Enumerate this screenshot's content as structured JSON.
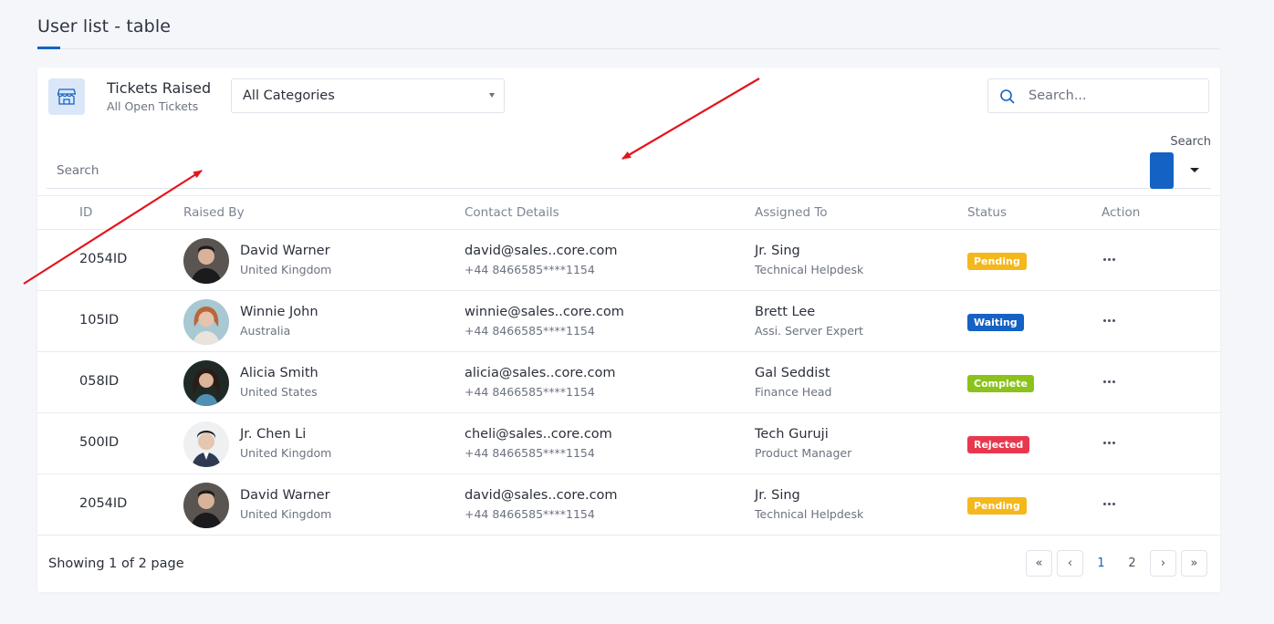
{
  "page": {
    "title": "User list - table"
  },
  "card": {
    "title": "Tickets Raised",
    "subtitle": "All Open Tickets",
    "category_select": {
      "value": "All Categories"
    },
    "top_search": {
      "placeholder": "Search..."
    },
    "search_bar": {
      "label": "Search",
      "placeholder": "Search"
    }
  },
  "table": {
    "headers": {
      "id": "ID",
      "raised_by": "Raised By",
      "contact": "Contact Details",
      "assigned": "Assigned To",
      "status": "Status",
      "action": "Action"
    },
    "rows": [
      {
        "id": "2054ID",
        "name": "David Warner",
        "country": "United Kingdom",
        "email": "david@sales..core.com",
        "phone": "+44 8466585****1154",
        "assigned": "Jr. Sing",
        "role": "Technical Helpdesk",
        "status": "Pending"
      },
      {
        "id": "105ID",
        "name": "Winnie John",
        "country": "Australia",
        "email": "winnie@sales..core.com",
        "phone": "+44 8466585****1154",
        "assigned": "Brett Lee",
        "role": "Assi. Server Expert",
        "status": "Waiting"
      },
      {
        "id": "058ID",
        "name": "Alicia Smith",
        "country": "United States",
        "email": "alicia@sales..core.com",
        "phone": "+44 8466585****1154",
        "assigned": "Gal Seddist",
        "role": "Finance Head",
        "status": "Complete"
      },
      {
        "id": "500ID",
        "name": "Jr. Chen Li",
        "country": "United Kingdom",
        "email": "cheli@sales..core.com",
        "phone": "+44 8466585****1154",
        "assigned": "Tech Guruji",
        "role": "Product Manager",
        "status": "Rejected"
      },
      {
        "id": "2054ID",
        "name": "David Warner",
        "country": "United Kingdom",
        "email": "david@sales..core.com",
        "phone": "+44 8466585****1154",
        "assigned": "Jr. Sing",
        "role": "Technical Helpdesk",
        "status": "Pending"
      }
    ]
  },
  "status_colors": {
    "Pending": "#f4b71c",
    "Waiting": "#1462c4",
    "Complete": "#8cc21c",
    "Rejected": "#e8384f"
  },
  "footer": {
    "showing": "Showing 1 of 2 page"
  },
  "pagination": {
    "first": "«",
    "prev": "‹",
    "pages": [
      "1",
      "2"
    ],
    "next": "›",
    "last": "»",
    "current": "1"
  },
  "icons": {
    "store": "store-icon",
    "search": "search-icon",
    "action": "more-horizontal-icon"
  },
  "accent_color": "#1462c4"
}
